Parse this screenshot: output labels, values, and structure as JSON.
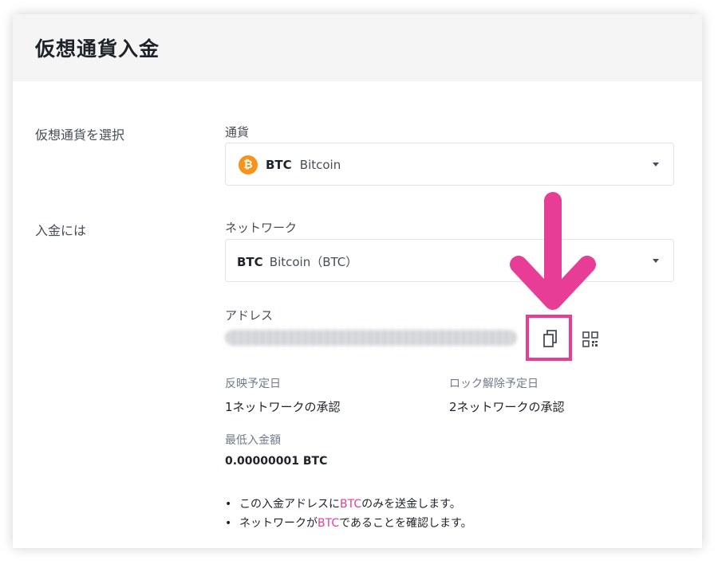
{
  "header": {
    "title": "仮想通貨入金"
  },
  "sections": {
    "select_crypto_label": "仮想通貨を選択",
    "deposit_to_label": "入金には"
  },
  "currency": {
    "label": "通貨",
    "selected_symbol": "BTC",
    "selected_name": "Bitcoin",
    "icon": "bitcoin-icon"
  },
  "network": {
    "label": "ネットワーク",
    "selected_symbol": "BTC",
    "selected_name": "Bitcoin（BTC）"
  },
  "address": {
    "label": "アドレス",
    "copy_icon": "copy-icon",
    "qr_icon": "qr-code-icon"
  },
  "info": {
    "arrival_label": "反映予定日",
    "arrival_value": "1ネットワークの承認",
    "unlock_label": "ロック解除予定日",
    "unlock_value": "2ネットワークの承認",
    "min_label": "最低入金額",
    "min_value": "0.00000001 BTC"
  },
  "notes": [
    {
      "before": "この入金アドレスに",
      "highlight": "BTC",
      "after": "のみを送金します。"
    },
    {
      "before": "ネットワークが",
      "highlight": "BTC",
      "after": "であることを確認します。"
    }
  ],
  "colors": {
    "highlight_pink": "#e83d96",
    "bitcoin_orange": "#f7931a",
    "header_bg": "#f5f5f5"
  }
}
